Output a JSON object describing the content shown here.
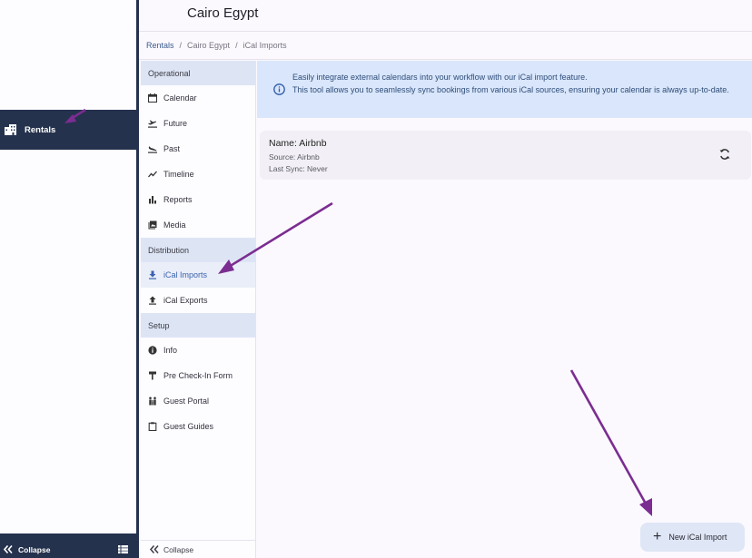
{
  "app_nav": {
    "rentals_label": "Rentals",
    "collapse_label": "Collapse"
  },
  "header": {
    "title": "Cairo Egypt"
  },
  "breadcrumb": {
    "items": [
      "Rentals",
      "Cairo Egypt",
      "iCal Imports"
    ]
  },
  "sidebar": {
    "sections": [
      {
        "title": "Operational",
        "items": [
          {
            "label": "Calendar",
            "icon": "calendar-icon"
          },
          {
            "label": "Future",
            "icon": "flight-takeoff-icon"
          },
          {
            "label": "Past",
            "icon": "flight-land-icon"
          },
          {
            "label": "Timeline",
            "icon": "trending-icon"
          },
          {
            "label": "Reports",
            "icon": "bar-chart-icon"
          },
          {
            "label": "Media",
            "icon": "photo-library-icon"
          }
        ]
      },
      {
        "title": "Distribution",
        "items": [
          {
            "label": "iCal Imports",
            "icon": "download-icon",
            "active": true
          },
          {
            "label": "iCal Exports",
            "icon": "upload-icon"
          }
        ]
      },
      {
        "title": "Setup",
        "items": [
          {
            "label": "Info",
            "icon": "info-icon"
          },
          {
            "label": "Pre Check-In Form",
            "icon": "form-icon"
          },
          {
            "label": "Guest Portal",
            "icon": "people-icon"
          },
          {
            "label": "Guest Guides",
            "icon": "clipboard-icon"
          }
        ]
      }
    ],
    "collapse_label": "Collapse"
  },
  "banner": {
    "line1": "Easily integrate external calendars into your workflow with our iCal import feature.",
    "line2": "This tool allows you to seamlessly sync bookings from various iCal sources, ensuring your calendar is always up-to-date."
  },
  "import_card": {
    "name": "Name: Airbnb",
    "source": "Source: Airbnb",
    "last_sync": "Last Sync: Never"
  },
  "actions": {
    "new_import_label": "New iCal Import"
  },
  "colors": {
    "nav_dark": "#25324d",
    "accent": "#3b62b0",
    "banner_bg": "#d9e6fb",
    "annotation_arrow": "#7b2d91"
  }
}
